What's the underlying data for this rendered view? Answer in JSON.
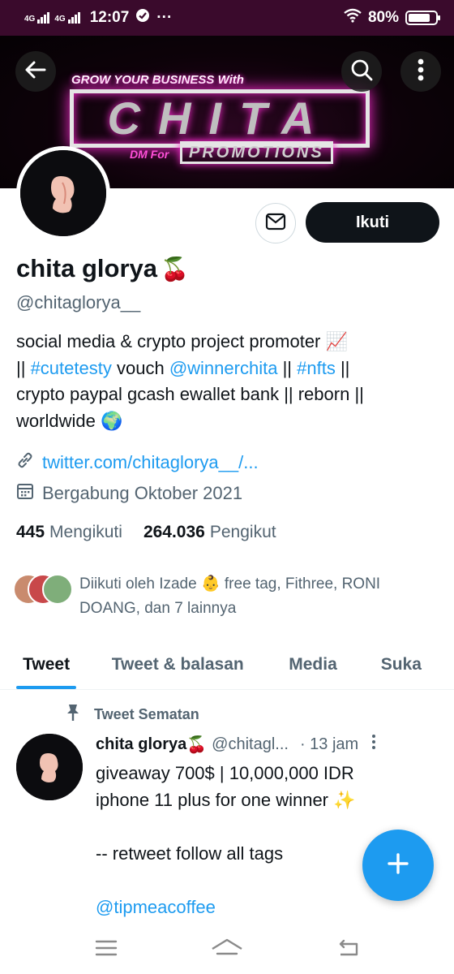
{
  "status_bar": {
    "network1": "4G",
    "network2": "4G",
    "time": "12:07",
    "overflow": "···",
    "battery": "80%",
    "battery_level": 0.8
  },
  "banner": {
    "tagline": "GROW YOUR BUSINESS With",
    "brand": "CHITA",
    "dm_text": "DM For",
    "promo_text": "PROMOTIONS"
  },
  "profile": {
    "display_name": "chita glorya",
    "name_emoji": "🍒",
    "handle": "@chitaglorya__",
    "follow_label": "Ikuti",
    "bio_line1": "social media & crypto project promoter",
    "bio_line1_emoji": "📈",
    "bio_sep1": "||",
    "bio_hashtag1": "#cutetesty",
    "bio_vouch": "vouch",
    "bio_mention": "@winnerchita",
    "bio_sep2": "||",
    "bio_hashtag2": "#nfts",
    "bio_sep3": "||",
    "bio_line3": "crypto paypal gcash ewallet bank || reborn ||",
    "bio_line4": "worldwide",
    "bio_line4_emoji": "🌍",
    "website": "twitter.com/chitaglorya__/...",
    "joined": "Bergabung Oktober 2021",
    "following_count": "445",
    "following_label": "Mengikuti",
    "followers_count": "264.036",
    "followers_label": "Pengikut",
    "followed_by_line1": "Diikuti oleh Izade 👶 free tag, Fithree, RONI",
    "followed_by_line2": "DOANG, dan 7 lainnya"
  },
  "tabs": [
    {
      "label": "Tweet"
    },
    {
      "label": "Tweet & balasan"
    },
    {
      "label": "Media"
    },
    {
      "label": "Suka"
    }
  ],
  "pinned_label": "Tweet Sematan",
  "tweet": {
    "name": "chita glorya",
    "name_emoji": "🍒",
    "handle": "@chitagl...",
    "time": "· 13 jam",
    "line1": "giveaway 700$ | 10,000,000 IDR",
    "line2": "iphone 11 plus for one winner",
    "line2_emoji": "✨",
    "line3": "-- retweet follow all tags",
    "line4": "@tipmeacoffee"
  },
  "colors": {
    "accent": "#1d9bf0",
    "text": "#0f1419",
    "muted": "#536471",
    "status_bar": "#3a0a2c",
    "neon": "#ff2bd4"
  },
  "icons": [
    "back-arrow-icon",
    "search-icon",
    "more-vertical-icon",
    "mail-icon",
    "link-icon",
    "calendar-icon",
    "pin-icon",
    "compose-plus-icon",
    "menu-icon",
    "home-icon",
    "back-icon"
  ]
}
